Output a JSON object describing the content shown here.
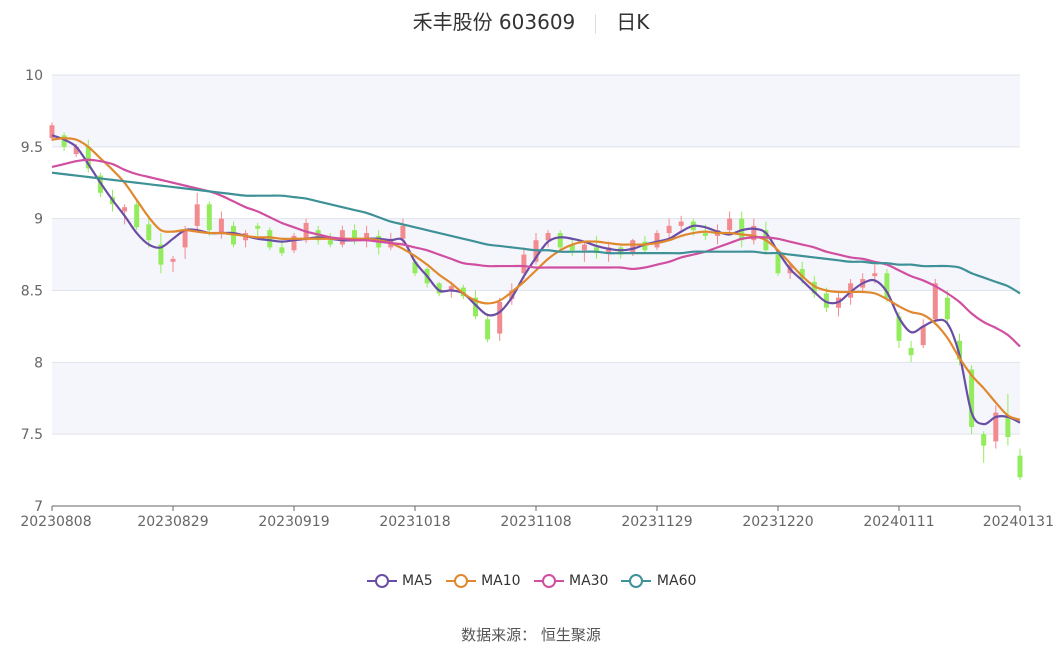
{
  "header": {
    "title": "禾丰股份 603609",
    "period": "日K"
  },
  "source": "数据来源： 恒生聚源",
  "chart_data": {
    "type": "candlestick",
    "ylim": [
      7,
      10
    ],
    "yticks": [
      "7",
      "7.5",
      "8",
      "8.5",
      "9",
      "9.5",
      "10"
    ],
    "xticks": [
      "20230808",
      "20230829",
      "20230919",
      "20231018",
      "20231108",
      "20231129",
      "20231220",
      "20240111",
      "20240131"
    ],
    "colors": {
      "up": "#f28b8f",
      "down": "#93ec5c",
      "band": "#f5f6fb",
      "grid": "#e0e3ee"
    },
    "series": [
      {
        "name": "MA5",
        "color": "#6a4ea6",
        "values": [
          9.58,
          9.55,
          9.5,
          9.38,
          9.25,
          9.13,
          9.02,
          8.9,
          8.82,
          8.8,
          8.86,
          8.92,
          8.92,
          8.9,
          8.9,
          8.9,
          8.88,
          8.86,
          8.85,
          8.84,
          8.85,
          8.86,
          8.87,
          8.86,
          8.85,
          8.85,
          8.86,
          8.86,
          8.85,
          8.85,
          8.7,
          8.6,
          8.5,
          8.5,
          8.48,
          8.4,
          8.33,
          8.35,
          8.45,
          8.6,
          8.73,
          8.84,
          8.87,
          8.86,
          8.84,
          8.81,
          8.79,
          8.78,
          8.79,
          8.82,
          8.84,
          8.86,
          8.91,
          8.95,
          8.94,
          8.91,
          8.89,
          8.92,
          8.93,
          8.9,
          8.77,
          8.65,
          8.57,
          8.49,
          8.42,
          8.42,
          8.49,
          8.55,
          8.57,
          8.49,
          8.31,
          8.21,
          8.25,
          8.29,
          8.27,
          8.05,
          7.65,
          7.57,
          7.62,
          7.62,
          7.58
        ]
      },
      {
        "name": "MA10",
        "color": "#e0882e",
        "values": [
          9.55,
          9.56,
          9.55,
          9.5,
          9.42,
          9.34,
          9.25,
          9.13,
          9.01,
          8.92,
          8.91,
          8.92,
          8.91,
          8.9,
          8.9,
          8.89,
          8.88,
          8.87,
          8.87,
          8.86,
          8.86,
          8.86,
          8.86,
          8.86,
          8.86,
          8.86,
          8.86,
          8.85,
          8.83,
          8.79,
          8.74,
          8.68,
          8.61,
          8.55,
          8.48,
          8.43,
          8.41,
          8.43,
          8.49,
          8.56,
          8.64,
          8.72,
          8.78,
          8.82,
          8.84,
          8.84,
          8.83,
          8.82,
          8.82,
          8.82,
          8.83,
          8.85,
          8.88,
          8.9,
          8.91,
          8.9,
          8.9,
          8.89,
          8.88,
          8.85,
          8.78,
          8.69,
          8.6,
          8.53,
          8.5,
          8.49,
          8.49,
          8.49,
          8.48,
          8.44,
          8.39,
          8.35,
          8.33,
          8.27,
          8.17,
          8.03,
          7.91,
          7.82,
          7.72,
          7.63,
          7.6
        ]
      },
      {
        "name": "MA30",
        "color": "#d14fa0",
        "values": [
          9.36,
          9.38,
          9.4,
          9.41,
          9.4,
          9.38,
          9.34,
          9.31,
          9.29,
          9.27,
          9.25,
          9.23,
          9.21,
          9.19,
          9.16,
          9.12,
          9.08,
          9.05,
          9.01,
          8.97,
          8.94,
          8.91,
          8.89,
          8.87,
          8.86,
          8.85,
          8.85,
          8.84,
          8.83,
          8.82,
          8.8,
          8.78,
          8.75,
          8.72,
          8.69,
          8.68,
          8.67,
          8.67,
          8.67,
          8.67,
          8.66,
          8.66,
          8.66,
          8.66,
          8.66,
          8.66,
          8.66,
          8.66,
          8.65,
          8.66,
          8.68,
          8.7,
          8.73,
          8.75,
          8.77,
          8.8,
          8.83,
          8.86,
          8.87,
          8.87,
          8.86,
          8.84,
          8.82,
          8.8,
          8.77,
          8.75,
          8.73,
          8.72,
          8.7,
          8.68,
          8.64,
          8.6,
          8.57,
          8.53,
          8.48,
          8.42,
          8.34,
          8.28,
          8.24,
          8.19,
          8.11
        ]
      },
      {
        "name": "MA60",
        "color": "#3e9197",
        "values": [
          9.32,
          9.31,
          9.3,
          9.29,
          9.28,
          9.27,
          9.26,
          9.25,
          9.24,
          9.23,
          9.22,
          9.21,
          9.2,
          9.19,
          9.18,
          9.17,
          9.16,
          9.16,
          9.16,
          9.16,
          9.15,
          9.14,
          9.12,
          9.1,
          9.08,
          9.06,
          9.04,
          9.01,
          8.98,
          8.96,
          8.94,
          8.92,
          8.9,
          8.88,
          8.86,
          8.84,
          8.82,
          8.81,
          8.8,
          8.79,
          8.78,
          8.78,
          8.77,
          8.77,
          8.77,
          8.77,
          8.76,
          8.76,
          8.76,
          8.76,
          8.76,
          8.76,
          8.76,
          8.77,
          8.77,
          8.77,
          8.77,
          8.77,
          8.77,
          8.76,
          8.76,
          8.75,
          8.74,
          8.73,
          8.72,
          8.71,
          8.7,
          8.7,
          8.69,
          8.69,
          8.68,
          8.68,
          8.67,
          8.67,
          8.67,
          8.66,
          8.62,
          8.59,
          8.56,
          8.53,
          8.48
        ]
      }
    ],
    "ohlc": [
      [
        9.56,
        9.67,
        9.54,
        9.65
      ],
      [
        9.58,
        9.6,
        9.47,
        9.5
      ],
      [
        9.45,
        9.52,
        9.43,
        9.5
      ],
      [
        9.5,
        9.55,
        9.32,
        9.35
      ],
      [
        9.3,
        9.32,
        9.15,
        9.18
      ],
      [
        9.15,
        9.2,
        9.05,
        9.1
      ],
      [
        9.05,
        9.1,
        8.96,
        9.08
      ],
      [
        9.1,
        9.14,
        8.92,
        8.94
      ],
      [
        8.96,
        9.02,
        8.8,
        8.85
      ],
      [
        8.82,
        8.9,
        8.62,
        8.68
      ],
      [
        8.7,
        8.74,
        8.63,
        8.72
      ],
      [
        8.8,
        8.95,
        8.72,
        8.92
      ],
      [
        8.95,
        9.18,
        8.92,
        9.1
      ],
      [
        9.1,
        9.12,
        8.88,
        8.92
      ],
      [
        8.9,
        9.05,
        8.86,
        9.0
      ],
      [
        8.95,
        8.98,
        8.8,
        8.82
      ],
      [
        8.85,
        8.92,
        8.8,
        8.9
      ],
      [
        8.95,
        8.97,
        8.88,
        8.93
      ],
      [
        8.92,
        8.94,
        8.78,
        8.8
      ],
      [
        8.8,
        8.85,
        8.74,
        8.76
      ],
      [
        8.78,
        8.9,
        8.76,
        8.88
      ],
      [
        8.85,
        9.0,
        8.83,
        8.97
      ],
      [
        8.92,
        8.95,
        8.82,
        8.85
      ],
      [
        8.85,
        8.9,
        8.8,
        8.82
      ],
      [
        8.82,
        8.95,
        8.8,
        8.92
      ],
      [
        8.92,
        8.96,
        8.82,
        8.85
      ],
      [
        8.85,
        8.95,
        8.8,
        8.9
      ],
      [
        8.88,
        8.92,
        8.75,
        8.8
      ],
      [
        8.8,
        8.9,
        8.78,
        8.86
      ],
      [
        8.86,
        9.0,
        8.82,
        8.95
      ],
      [
        8.7,
        8.72,
        8.6,
        8.62
      ],
      [
        8.65,
        8.66,
        8.52,
        8.55
      ],
      [
        8.55,
        8.56,
        8.46,
        8.48
      ],
      [
        8.5,
        8.56,
        8.45,
        8.53
      ],
      [
        8.52,
        8.54,
        8.44,
        8.46
      ],
      [
        8.45,
        8.5,
        8.3,
        8.32
      ],
      [
        8.3,
        8.34,
        8.14,
        8.16
      ],
      [
        8.2,
        8.45,
        8.15,
        8.42
      ],
      [
        8.44,
        8.55,
        8.4,
        8.5
      ],
      [
        8.62,
        8.8,
        8.58,
        8.75
      ],
      [
        8.7,
        8.9,
        8.68,
        8.85
      ],
      [
        8.85,
        8.92,
        8.8,
        8.9
      ],
      [
        8.9,
        8.92,
        8.78,
        8.8
      ],
      [
        8.82,
        8.86,
        8.74,
        8.78
      ],
      [
        8.78,
        8.84,
        8.7,
        8.82
      ],
      [
        8.8,
        8.88,
        8.72,
        8.76
      ],
      [
        8.76,
        8.84,
        8.7,
        8.8
      ],
      [
        8.8,
        8.82,
        8.72,
        8.75
      ],
      [
        8.76,
        8.86,
        8.74,
        8.85
      ],
      [
        8.84,
        8.88,
        8.76,
        8.78
      ],
      [
        8.8,
        8.92,
        8.78,
        8.9
      ],
      [
        8.9,
        9.0,
        8.85,
        8.95
      ],
      [
        8.95,
        9.02,
        8.9,
        8.98
      ],
      [
        8.98,
        9.0,
        8.88,
        8.92
      ],
      [
        8.9,
        8.96,
        8.85,
        8.88
      ],
      [
        8.88,
        8.96,
        8.82,
        8.92
      ],
      [
        8.92,
        9.05,
        8.9,
        9.0
      ],
      [
        9.0,
        9.05,
        8.8,
        8.85
      ],
      [
        8.85,
        9.0,
        8.82,
        8.95
      ],
      [
        8.92,
        8.98,
        8.75,
        8.78
      ],
      [
        8.75,
        8.76,
        8.6,
        8.62
      ],
      [
        8.62,
        8.7,
        8.58,
        8.68
      ],
      [
        8.65,
        8.7,
        8.55,
        8.58
      ],
      [
        8.56,
        8.6,
        8.45,
        8.48
      ],
      [
        8.48,
        8.52,
        8.35,
        8.38
      ],
      [
        8.38,
        8.5,
        8.32,
        8.45
      ],
      [
        8.45,
        8.58,
        8.4,
        8.55
      ],
      [
        8.52,
        8.62,
        8.48,
        8.58
      ],
      [
        8.6,
        8.68,
        8.55,
        8.62
      ],
      [
        8.62,
        8.65,
        8.42,
        8.45
      ],
      [
        8.32,
        8.35,
        8.1,
        8.15
      ],
      [
        8.1,
        8.15,
        8.0,
        8.05
      ],
      [
        8.12,
        8.3,
        8.1,
        8.25
      ],
      [
        8.3,
        8.58,
        8.28,
        8.55
      ],
      [
        8.45,
        8.5,
        8.25,
        8.3
      ],
      [
        8.15,
        8.2,
        7.98,
        8.02
      ],
      [
        7.95,
        7.98,
        7.5,
        7.55
      ],
      [
        7.5,
        7.52,
        7.3,
        7.42
      ],
      [
        7.45,
        7.7,
        7.4,
        7.65
      ],
      [
        7.62,
        7.78,
        7.42,
        7.48
      ],
      [
        7.35,
        7.4,
        7.18,
        7.2
      ]
    ]
  }
}
